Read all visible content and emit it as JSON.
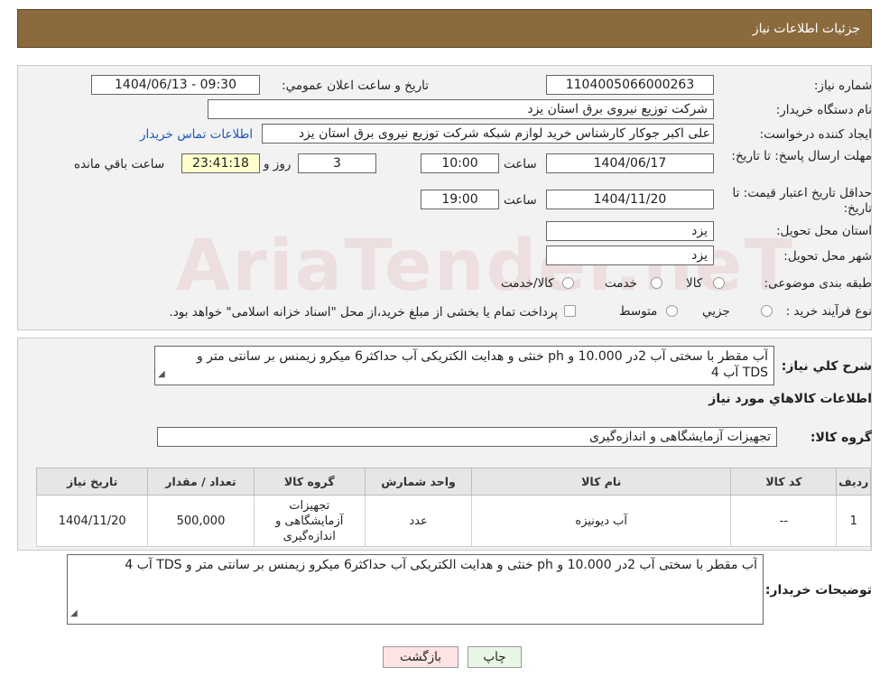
{
  "header": {
    "title": "جزئیات اطلاعات نیاز"
  },
  "form": {
    "need_number": {
      "label": "شماره نیاز:",
      "value": "1104005066000263"
    },
    "announce": {
      "label": "تاریخ و ساعت اعلان عمومي:",
      "value": "1404/06/13 - 09:30"
    },
    "buyer": {
      "label": "نام دستگاه خریدار:",
      "value": "شرکت توزیع نیروی برق استان یزد"
    },
    "requester": {
      "label": "ایجاد کننده درخواست:",
      "value": "علی اکبر  جوکار  کارشناس خرید لوازم شبکه  شرکت توزیع نیروی برق استان یزد",
      "contact_link": "اطلاعات تماس خریدار"
    },
    "deadline": {
      "label": "مهلت ارسال پاسخ: تا تاریخ:",
      "date": "1404/06/17",
      "time_label": "ساعت",
      "time": "10:00",
      "days": "3",
      "days_label": "روز و",
      "remaining": "23:41:18",
      "remaining_label": "ساعت باقي مانده"
    },
    "validity": {
      "label": "حداقل تاریخ اعتبار قیمت: تا تاریخ:",
      "date": "1404/11/20",
      "time_label": "ساعت",
      "time": "19:00"
    },
    "province": {
      "label": "استان محل تحویل:",
      "value": "یزد"
    },
    "city": {
      "label": "شهر محل تحویل:",
      "value": "یزد"
    },
    "category": {
      "label": "طبقه بندی موضوعی:",
      "options": [
        "کالا",
        "خدمت",
        "کالا/خدمت"
      ]
    },
    "process": {
      "label": "نوع فرآیند خرید :",
      "options": [
        "جزیي",
        "متوسط"
      ],
      "note": "پرداخت تمام یا بخشی از مبلغ خرید،از محل \"اسناد خزانه اسلامی\" خواهد بود."
    }
  },
  "watermark": "AriaTender.neT",
  "summary": {
    "label": "شرح کلي نیاز:",
    "line1": "آب مقطر با سختی آب 2در 10.000 و ph خنثی و  هدایت الکتریکی آب حداکثر6  میکرو زیمنس بر سانتی متر    و",
    "line2": "TDS آب 4"
  },
  "goods_info": {
    "title": "اطلاعات کالاهاي مورد نیاز"
  },
  "goods_group": {
    "label": "گروه کالا:",
    "value": "تجهیزات آزمایشگاهی و اندازه‌گیری"
  },
  "table": {
    "headers": [
      "ردیف",
      "کد کالا",
      "نام کالا",
      "واحد شمارش",
      "گروه کالا",
      "تعداد / مقدار",
      "تاریخ نیاز"
    ],
    "rows": [
      {
        "row": "1",
        "code": "--",
        "name": "آب دیونیزه",
        "unit": "عدد",
        "group": "تجهیزات آزمایشگاهی و اندازه‌گیری",
        "qty": "500,000",
        "date": "1404/11/20"
      }
    ]
  },
  "buyer_notes": {
    "label": "توضیحات خریدار:",
    "text": "آب مقطر با سختی آب 2در 10.000 و ph خنثی و  هدایت الکتریکی آب حداکثر6  میکرو زیمنس بر سانتی متر    و  TDS آب 4"
  },
  "buttons": {
    "print": "چاپ",
    "back": "بازگشت"
  },
  "colors": {
    "header_bg": "#8b6a3e",
    "panel_bg": "#f2f2f2",
    "highlight": "#ffffcc",
    "print_bg": "#e8f7e4",
    "back_bg": "#fde3e3",
    "link": "#1a56c4"
  }
}
